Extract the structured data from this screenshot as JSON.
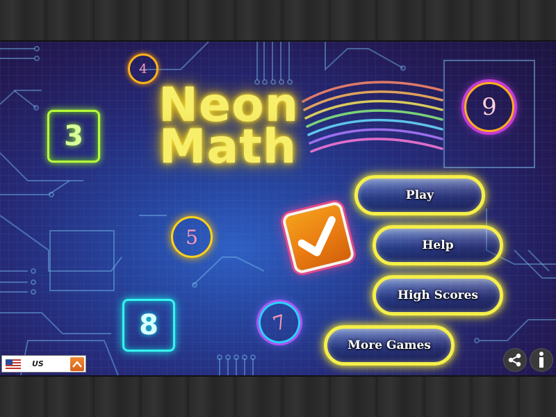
{
  "game": {
    "title_line1": "Neon",
    "title_line2": "Math"
  },
  "menu": {
    "play_label": "Play",
    "help_label": "Help",
    "high_scores_label": "High Scores",
    "more_games_label": "More Games"
  },
  "decor_numbers": {
    "square_green": "3",
    "square_cyan": "8",
    "circle_small": "4",
    "circle_yellow": "5",
    "circle_framed": "9",
    "circle_purple": "7"
  },
  "locale": {
    "country": "US",
    "flag_icon": "us-flag-icon",
    "toggle_icon": "chevron-up-icon"
  },
  "footer": {
    "share_icon": "share-icon",
    "info_icon": "info-icon"
  },
  "colors": {
    "title": "#f7ef6a",
    "button_border": "#f5ef4a",
    "square_green": "#b7ff3a",
    "square_cyan": "#35f4f0",
    "check_badge": "#ea7c12"
  }
}
